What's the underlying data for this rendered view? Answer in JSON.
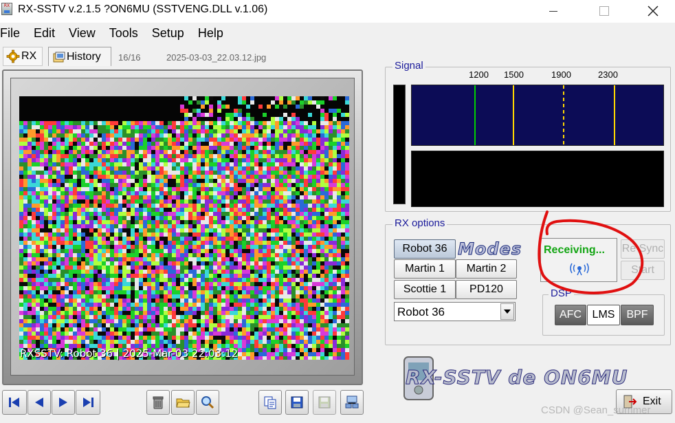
{
  "window": {
    "title": "RX-SSTV v.2.1.5 ?ON6MU (SSTVENG.DLL v.1.06)",
    "icon_text": "RX"
  },
  "menu": [
    "File",
    "Edit",
    "View",
    "Tools",
    "Setup",
    "Help"
  ],
  "tabs": {
    "rx": "RX",
    "history": "History"
  },
  "history": {
    "counter": "16/16",
    "filename": "2025-03-03_22.03.12.jpg"
  },
  "image": {
    "caption": "RXSSTV: Robot 36 | 2025-Mar-03 22:03:12"
  },
  "signal": {
    "label": "Signal",
    "freqs": [
      "1200",
      "1500",
      "1900",
      "2300"
    ],
    "colors": {
      "spectrum_bg": "#0c0c56",
      "sync_line": "#00d000",
      "marker_line": "#ffd800"
    }
  },
  "rx_options": {
    "label": "RX options",
    "modes_logo": "Modes",
    "buttons": [
      "Robot 36",
      "Martin 1",
      "Martin 2",
      "Scottie 1",
      "PD120"
    ],
    "selected_mode": "Robot 36",
    "status": "Receiving...",
    "status_color": "#12a512",
    "resync": "Re Sync",
    "start": "Start"
  },
  "dsp": {
    "label": "DSP",
    "buttons": [
      "AFC",
      "LMS",
      "BPF"
    ]
  },
  "logo": {
    "text": "RX-SSTV de ON6MU"
  },
  "footer": {
    "exit": "Exit",
    "watermark": "CSDN @Sean_summer"
  },
  "icons": {
    "nav": [
      "first-icon",
      "prev-icon",
      "next-icon",
      "last-icon"
    ],
    "tools": [
      "trash-icon",
      "folder-icon",
      "search-icon"
    ],
    "actions": [
      "copy-icon",
      "save-icon",
      "save-disabled-icon",
      "network-icon"
    ]
  }
}
